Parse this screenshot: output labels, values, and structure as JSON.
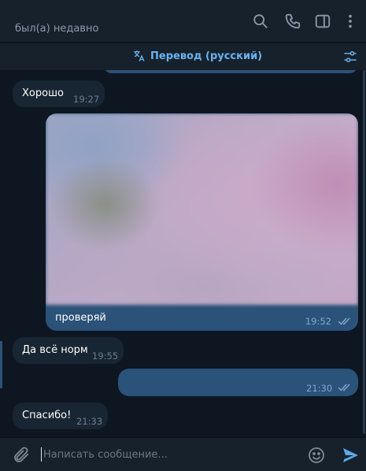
{
  "header": {
    "status": "был(а) недавно",
    "icons": [
      "search-icon",
      "phone-icon",
      "sidebar-panel-icon",
      "more-vertical-icon"
    ]
  },
  "translate_bar": {
    "label": "Перевод (русский)",
    "icon": "translate-icon",
    "settings_icon": "filter-settings-icon"
  },
  "messages": [
    {
      "direction": "in",
      "text": "Хорошо",
      "time": "19:27"
    },
    {
      "direction": "out",
      "type": "photo",
      "caption": "проверяй",
      "time": "19:52",
      "read": true
    },
    {
      "direction": "in",
      "text": "Да всё норм",
      "time": "19:55"
    },
    {
      "direction": "out",
      "text": "",
      "time": "21:30",
      "read": true
    },
    {
      "direction": "in",
      "text": "Спасибо!",
      "time": "21:33"
    }
  ],
  "composer": {
    "placeholder": "Написать сообщение...",
    "value": "",
    "icons": [
      "paperclip-icon",
      "emoji-icon",
      "send-icon"
    ]
  },
  "colors": {
    "background": "#0e1621",
    "panel": "#17212b",
    "bubble_in": "#182533",
    "bubble_out": "#2b5278",
    "accent": "#6ab3f3"
  }
}
